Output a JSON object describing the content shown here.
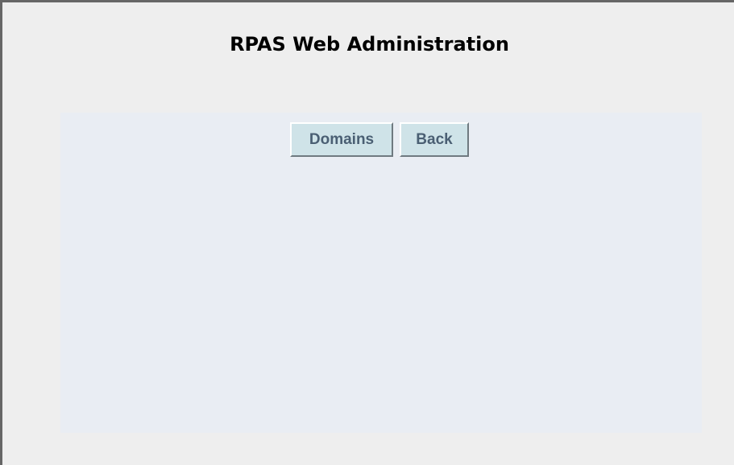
{
  "page": {
    "title": "RPAS Web Administration"
  },
  "actions": {
    "domains_label": "Domains",
    "back_label": "Back"
  },
  "colors": {
    "background": "#eeeeee",
    "panel": "#e9edf3",
    "button_face": "#cfe3e8",
    "button_text": "#4a5f73"
  }
}
